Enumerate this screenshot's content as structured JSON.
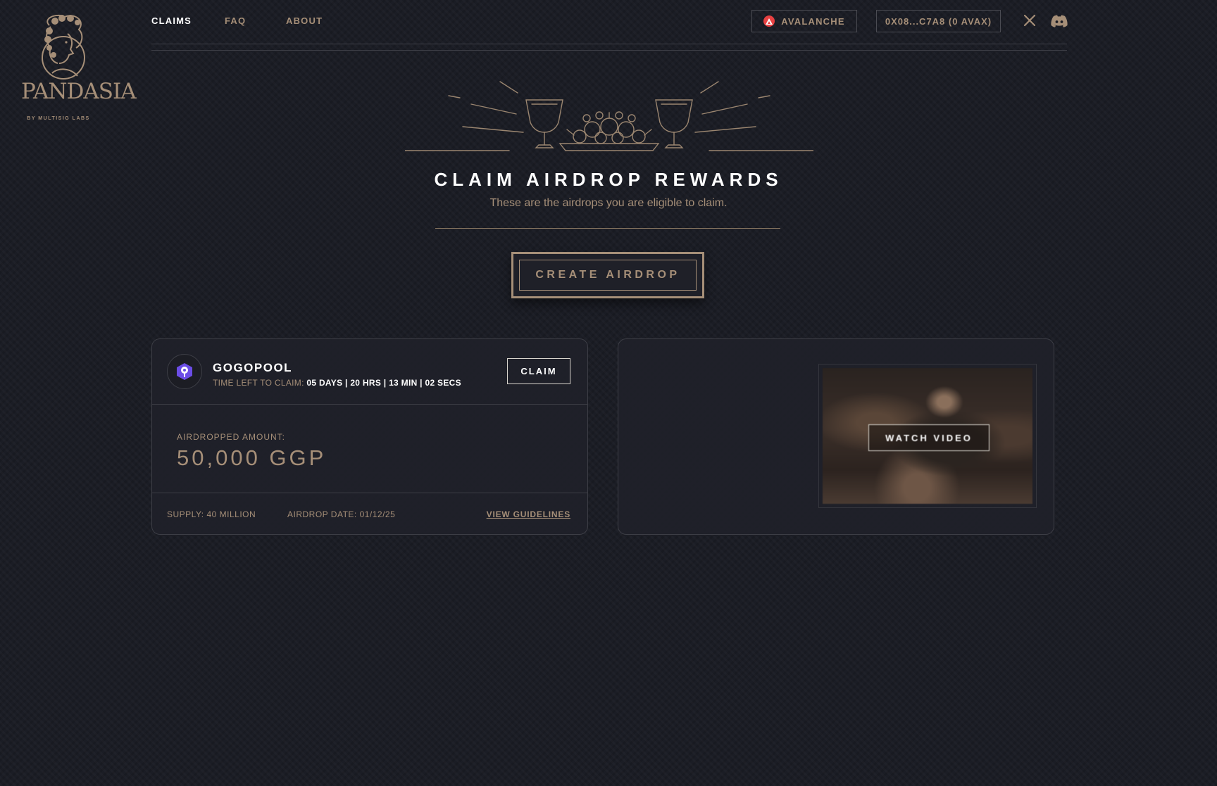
{
  "brand": {
    "logo_text": "PANDASIA",
    "tagline": "BY MULTISIG LABS"
  },
  "nav": {
    "items": [
      {
        "label": "CLAIMS",
        "active": true
      },
      {
        "label": "FAQ",
        "active": false
      },
      {
        "label": "ABOUT",
        "active": false
      }
    ]
  },
  "header": {
    "chain_label": "AVALANCHE",
    "wallet_label": "0X08...C7A8 (0 AVAX)",
    "social": [
      "x-icon",
      "discord-icon"
    ]
  },
  "hero": {
    "title": "CLAIM AIRDROP REWARDS",
    "subtitle": "These are the airdrops you are eligible to claim.",
    "create_button": "CREATE AIRDROP"
  },
  "claim_card": {
    "token_name": "GOGOPOOL",
    "time_left_label": "TIME LEFT TO CLAIM:",
    "time_left_value": "05 DAYS | 20 HRS | 13 MIN | 02 SECS",
    "claim_button": "CLAIM",
    "amount_label": "AIRDROPPED AMOUNT:",
    "amount_value": "50,000 GGP",
    "supply": "SUPPLY: 40 MILLION",
    "airdrop_date": "AIRDROP DATE: 01/12/25",
    "guidelines_link": "VIEW GUIDELINES"
  },
  "video_card": {
    "watch_button": "WATCH VIDEO"
  },
  "colors": {
    "background": "#1b1d25",
    "accent_gold": "#a68f78",
    "card_border": "#3d3e46",
    "avalanche_red": "#e84142",
    "gogopool_purple": "#6b4de6"
  }
}
